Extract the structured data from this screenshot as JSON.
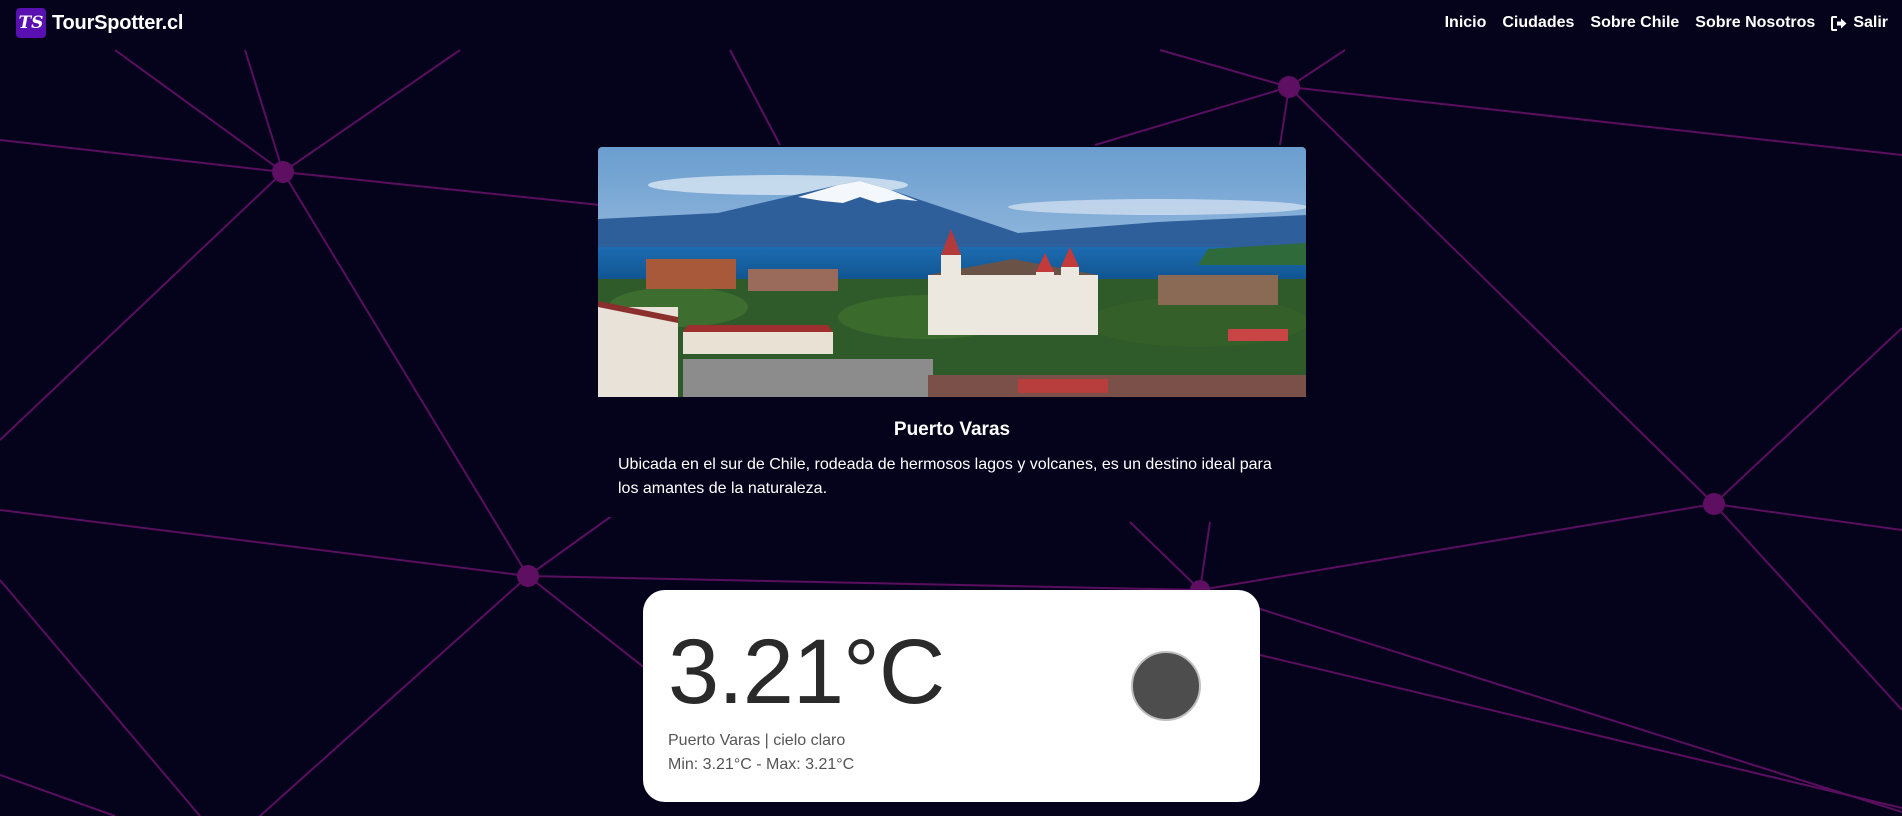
{
  "brand": {
    "logo_text": "TS",
    "name": "TourSpotter.cl"
  },
  "nav": {
    "items": [
      "Inicio",
      "Ciudades",
      "Sobre Chile",
      "Sobre Nosotros"
    ],
    "logout": "Salir"
  },
  "city": {
    "name": "Puerto Varas",
    "description": "Ubicada en el sur de Chile, rodeada de hermosos lagos y volcanes, es un destino ideal para los amantes de la naturaleza."
  },
  "weather": {
    "temperature": "3.21°C",
    "location_line": "Puerto Varas | cielo claro",
    "minmax_line": "Min: 3.21°C - Max: 3.21°C"
  },
  "colors": {
    "background": "#05021c",
    "network_line": "#5a0f5e",
    "network_node": "#5e0f62",
    "brand_logo": "#5a0fb0"
  }
}
